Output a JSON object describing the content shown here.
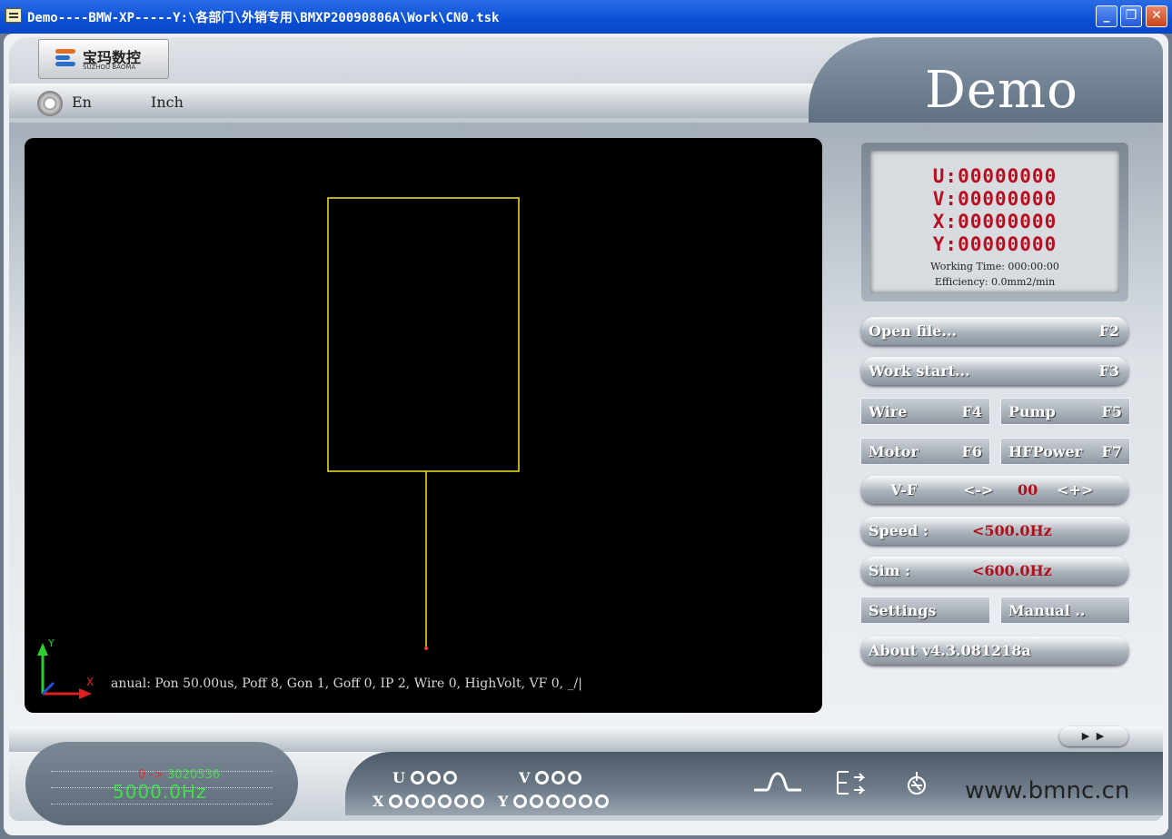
{
  "window": {
    "title": "Demo----BMW-XP-----Y:\\各部门\\外销专用\\BMXP20090806A\\Work\\CN0.tsk",
    "min_label": "_",
    "max_label": "❐",
    "close_label": "✕"
  },
  "header": {
    "logo_cn": "宝玛数控",
    "logo_en": "SUZHOU BAOMA",
    "lang": "En",
    "unit": "Inch",
    "brand": "Demo"
  },
  "canvas": {
    "status": "anual: Pon 50.00us, Poff 8, Gon 1, Goff 0, IP 2, Wire 0, HighVolt, VF 0, _/|",
    "axis_y": "Y",
    "axis_x": "X"
  },
  "lcd": {
    "u": "U:00000000",
    "v": "V:00000000",
    "x": "X:00000000",
    "y": "Y:00000000",
    "working_time": "Working Time: 000:00:00",
    "efficiency": "Efficiency:  0.0mm2/min"
  },
  "buttons": {
    "open_file": {
      "label": "Open file...",
      "key": "F2"
    },
    "work_start": {
      "label": "Work start...",
      "key": "F3"
    },
    "wire": {
      "label": "Wire",
      "key": "F4"
    },
    "pump": {
      "label": "Pump",
      "key": "F5"
    },
    "motor": {
      "label": "Motor",
      "key": "F6"
    },
    "hfpower": {
      "label": "HFPower",
      "key": "F7"
    },
    "vf": {
      "label": "V-F",
      "minus": "<->",
      "value": "00",
      "plus": "<+>"
    },
    "speed": {
      "label": "Speed :",
      "value": "<500.0Hz"
    },
    "sim": {
      "label": "Sim   :",
      "value": "<600.0Hz"
    },
    "settings": {
      "label": "Settings"
    },
    "manual": {
      "label": "Manual .."
    },
    "about": {
      "label": "About v4.3.081218a"
    },
    "page_arrows": "▶ ▶"
  },
  "footer": {
    "freq_arrow": "0 ->",
    "freq_target": "3020536",
    "freq_value": "5000.0Hz",
    "u_label": "U",
    "v_label": "V",
    "x_label": "X",
    "y_label": "Y",
    "icon_pulse": "pulse-icon",
    "icon_route": "route-icon",
    "icon_pump": "pump-icon",
    "website": "www.bmnc.cn"
  },
  "colors": {
    "lcd_digits": "#b80f20",
    "toolpath": "#e6d820",
    "freq_green": "#41e04a"
  }
}
